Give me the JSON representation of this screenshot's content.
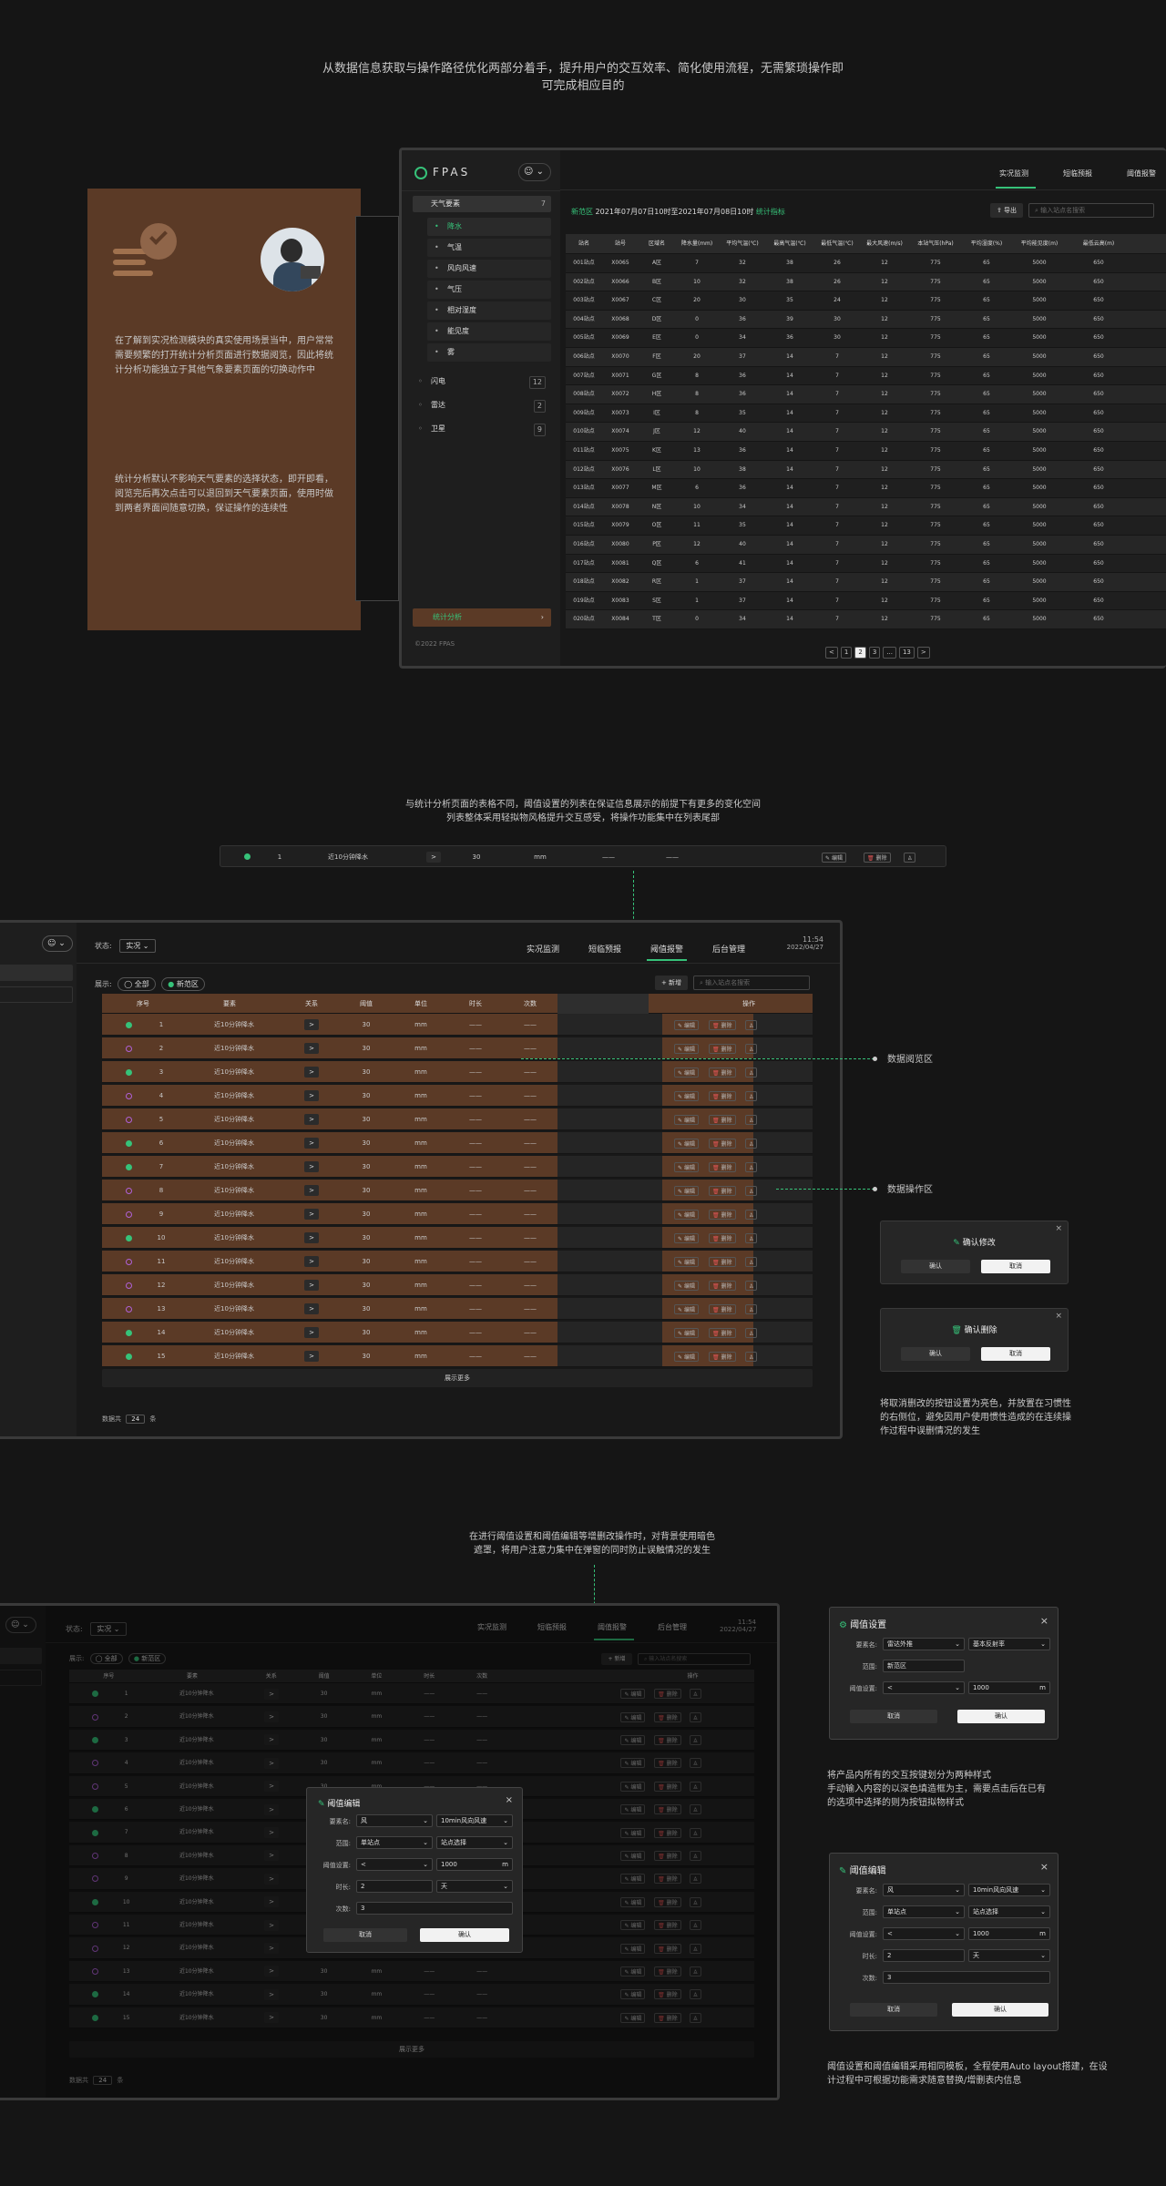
{
  "intro": {
    "line1": "从数据信息获取与操作路径优化两部分着手，提升用户的交互效率、简化使用流程，无需繁琐操作即",
    "line2": "可完成相应目的"
  },
  "note1": {
    "p1": "在了解到实况检测模块的真实使用场景当中，用户常常需要频繁的打开统计分析页面进行数据阅览，因此将统计分析功能独立于其他气象要素页面的切换动作中",
    "p2": "统计分析默认不影响天气要素的选择状态，即开即看，阅览完后再次点击可以退回到天气要素页面，使用时做到两者界面间随意切换，保证操作的连续性"
  },
  "app1": {
    "logo": "FPAS",
    "tabs": [
      "实况监测",
      "短临预报",
      "阈值报警"
    ],
    "sidebar": {
      "group": "天气要素",
      "group_count": "7",
      "items": [
        "降水",
        "气温",
        "风向风速",
        "气压",
        "相对湿度",
        "能见度",
        "雾"
      ],
      "others": [
        {
          "label": "闪电",
          "count": "12"
        },
        {
          "label": "雷达",
          "count": "2"
        },
        {
          "label": "卫星",
          "count": "9"
        }
      ],
      "stats": "统计分析",
      "copyright": "©2022 FPAS"
    },
    "filter": {
      "prefix": "新范区",
      "time": "2021年07月07日10时至2021年07月08日10时",
      "tag": "统计指标",
      "export": "导出",
      "search_placeholder": "输入站点名搜索"
    },
    "columns": [
      "站名",
      "站号",
      "区域名",
      "降水量(mm)",
      "平均气温(℃)",
      "最高气温(℃)",
      "最低气温(℃)",
      "最大风速(m/s)",
      "本站气压(hPa)",
      "平均湿度(%)",
      "平均能见度(m)",
      "最低云高(m)"
    ],
    "rows": [
      [
        "001站点",
        "X0065",
        "A区",
        "7",
        "32",
        "38",
        "26",
        "12",
        "775",
        "65",
        "5000",
        "650"
      ],
      [
        "002站点",
        "X0066",
        "B区",
        "10",
        "32",
        "38",
        "26",
        "12",
        "775",
        "65",
        "5000",
        "650"
      ],
      [
        "003站点",
        "X0067",
        "C区",
        "20",
        "30",
        "35",
        "24",
        "12",
        "775",
        "65",
        "5000",
        "650"
      ],
      [
        "004站点",
        "X0068",
        "D区",
        "0",
        "36",
        "39",
        "30",
        "12",
        "775",
        "65",
        "5000",
        "650"
      ],
      [
        "005站点",
        "X0069",
        "E区",
        "0",
        "34",
        "36",
        "30",
        "12",
        "775",
        "65",
        "5000",
        "650"
      ],
      [
        "006站点",
        "X0070",
        "F区",
        "20",
        "37",
        "14",
        "7",
        "12",
        "775",
        "65",
        "5000",
        "650"
      ],
      [
        "007站点",
        "X0071",
        "G区",
        "8",
        "36",
        "14",
        "7",
        "12",
        "775",
        "65",
        "5000",
        "650"
      ],
      [
        "008站点",
        "X0072",
        "H区",
        "8",
        "36",
        "14",
        "7",
        "12",
        "775",
        "65",
        "5000",
        "650"
      ],
      [
        "009站点",
        "X0073",
        "I区",
        "8",
        "35",
        "14",
        "7",
        "12",
        "775",
        "65",
        "5000",
        "650"
      ],
      [
        "010站点",
        "X0074",
        "J区",
        "12",
        "40",
        "14",
        "7",
        "12",
        "775",
        "65",
        "5000",
        "650"
      ],
      [
        "011站点",
        "X0075",
        "K区",
        "13",
        "36",
        "14",
        "7",
        "12",
        "775",
        "65",
        "5000",
        "650"
      ],
      [
        "012站点",
        "X0076",
        "L区",
        "10",
        "38",
        "14",
        "7",
        "12",
        "775",
        "65",
        "5000",
        "650"
      ],
      [
        "013站点",
        "X0077",
        "M区",
        "6",
        "36",
        "14",
        "7",
        "12",
        "775",
        "65",
        "5000",
        "650"
      ],
      [
        "014站点",
        "X0078",
        "N区",
        "10",
        "34",
        "14",
        "7",
        "12",
        "775",
        "65",
        "5000",
        "650"
      ],
      [
        "015站点",
        "X0079",
        "O区",
        "11",
        "35",
        "14",
        "7",
        "12",
        "775",
        "65",
        "5000",
        "650"
      ],
      [
        "016站点",
        "X0080",
        "P区",
        "12",
        "40",
        "14",
        "7",
        "12",
        "775",
        "65",
        "5000",
        "650"
      ],
      [
        "017站点",
        "X0081",
        "Q区",
        "6",
        "41",
        "14",
        "7",
        "12",
        "775",
        "65",
        "5000",
        "650"
      ],
      [
        "018站点",
        "X0082",
        "R区",
        "1",
        "37",
        "14",
        "7",
        "12",
        "775",
        "65",
        "5000",
        "650"
      ],
      [
        "019站点",
        "X0083",
        "S区",
        "1",
        "37",
        "14",
        "7",
        "12",
        "775",
        "65",
        "5000",
        "650"
      ],
      [
        "020站点",
        "X0084",
        "T区",
        "0",
        "34",
        "14",
        "7",
        "12",
        "775",
        "65",
        "5000",
        "650"
      ]
    ],
    "pagination": [
      "<",
      "1",
      "2",
      "3",
      "...",
      "13",
      ">"
    ]
  },
  "sec2_caption": {
    "line1": "与统计分析页面的表格不同，阈值设置的列表在保证信息展示的前提下有更多的变化空间",
    "line2": "列表整体采用轻拟物风格提升交互感受，将操作功能集中在列表尾部"
  },
  "single_row": {
    "index": "1",
    "element": "近10分钟降水",
    "rel": ">",
    "val": "30",
    "unit": "mm",
    "dur": "——",
    "times": "——",
    "edit": "编辑",
    "del": "删除"
  },
  "app2": {
    "status_label": "状态:",
    "status_value": "实况",
    "tabs": [
      "实况监测",
      "短临预报",
      "阈值报警",
      "后台管理"
    ],
    "time": "11:54",
    "date": "2022/04/27",
    "show_label": "展示:",
    "chip_all": "全部",
    "chip_area": "新范区",
    "add": "+ 新增",
    "search_placeholder": "输入站点名搜索",
    "columns": [
      "序号",
      "要素",
      "关系",
      "阈值",
      "单位",
      "时长",
      "次数",
      "操作"
    ],
    "element": "近10分钟降水",
    "rel": ">",
    "val": "30",
    "unit": "mm",
    "dash": "——",
    "edit": "编辑",
    "del": "删除",
    "on": [
      true,
      false,
      true,
      false,
      false,
      true,
      true,
      false,
      false,
      true,
      false,
      false,
      false,
      true,
      true
    ],
    "more": "展示更多",
    "footer": "数据共",
    "footer_count": "24",
    "footer_unit": "条"
  },
  "annotations": {
    "data_area": "数据阅览区",
    "edit_area": "数据操作区"
  },
  "confirm_edit": {
    "title": "确认修改",
    "ok": "确认",
    "cancel": "取消"
  },
  "confirm_del": {
    "title": "确认删除",
    "ok": "确认",
    "cancel": "取消"
  },
  "note2": "将取消删改的按钮设置为亮色，并放置在习惯性的右侧位，避免因用户使用惯性造成的在连续操作过程中误删情况的发生",
  "sec3_caption": {
    "line1": "在进行阈值设置和阈值编辑等增删改操作时，对背景使用暗色",
    "line2": "遮罩，将用户注意力集中在弹窗的同时防止误触情况的发生"
  },
  "modal_edit": {
    "title": "阈值编辑",
    "f1": "要素名:",
    "v1a": "风",
    "v1b": "10min风向风速",
    "f2": "范围:",
    "v2a": "单站点",
    "v2b": "站点选择",
    "f3": "阈值设置:",
    "v3a": "<",
    "v3b": "1000",
    "v3u": "m",
    "f4": "时长:",
    "v4a": "2",
    "v4b": "天",
    "f5": "次数:",
    "v5": "3",
    "cancel": "取消",
    "ok": "确认"
  },
  "modal_set": {
    "title": "阈值设置",
    "f1": "要素名:",
    "v1a": "雷达外推",
    "v1b": "基本反射率",
    "f2": "范围:",
    "v2": "新范区",
    "f3": "阈值设置:",
    "v3a": "<",
    "v3b": "1000",
    "v3u": "m",
    "cancel": "取消",
    "ok": "确认"
  },
  "note3": {
    "l1": "将产品内所有的交互按键划分为两种样式",
    "l2": "手动输入内容的以深色填造框为主，需要点击后在已有",
    "l3": "的选项中选择的则为按钮拟物样式"
  },
  "note4": "阈值设置和阈值编辑采用相同模板，全程使用Auto layout搭建，在设计过程中可根据功能需求随意替换/增删表内信息",
  "app3_footer_count": "24"
}
